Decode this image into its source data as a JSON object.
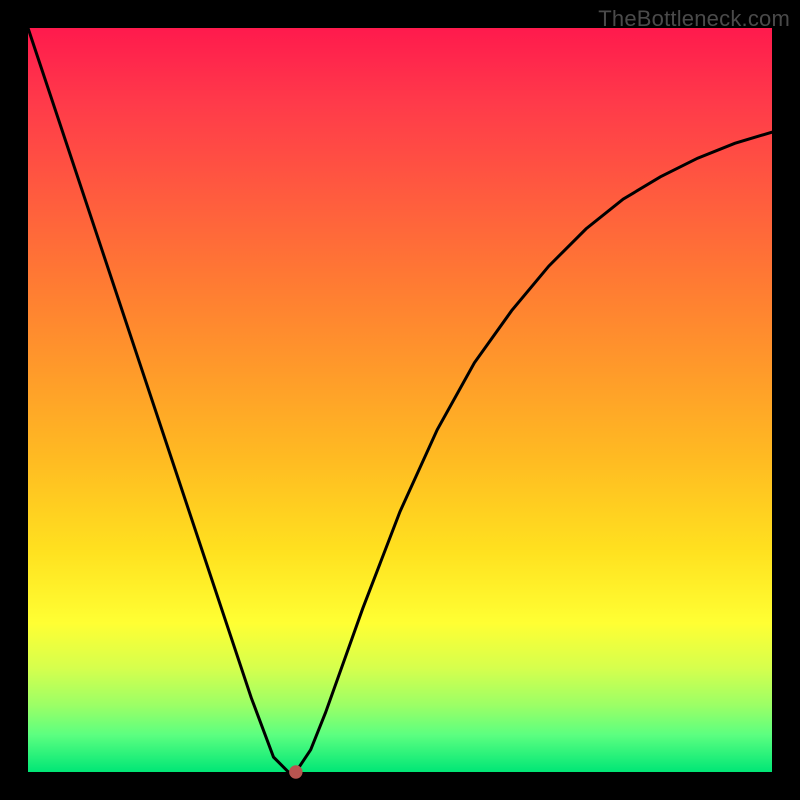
{
  "watermark": "TheBottleneck.com",
  "chart_data": {
    "type": "line",
    "title": "",
    "xlabel": "",
    "ylabel": "",
    "xlim": [
      0,
      100
    ],
    "ylim": [
      0,
      100
    ],
    "grid": false,
    "legend": false,
    "series": [
      {
        "name": "bottleneck-curve",
        "x": [
          0,
          5,
          10,
          15,
          20,
          25,
          30,
          33,
          35,
          36,
          38,
          40,
          45,
          50,
          55,
          60,
          65,
          70,
          75,
          80,
          85,
          90,
          95,
          100
        ],
        "values": [
          100,
          85,
          70,
          55,
          40,
          25,
          10,
          2,
          0,
          0,
          3,
          8,
          22,
          35,
          46,
          55,
          62,
          68,
          73,
          77,
          80,
          82.5,
          84.5,
          86
        ]
      }
    ],
    "marker": {
      "x": 36,
      "y": 0,
      "radius_pct": 0.9,
      "color": "#b85450"
    },
    "colors": {
      "curve": "#000000",
      "marker": "#b85450",
      "gradient_top": "#ff1a4d",
      "gradient_bottom": "#00e676"
    }
  }
}
